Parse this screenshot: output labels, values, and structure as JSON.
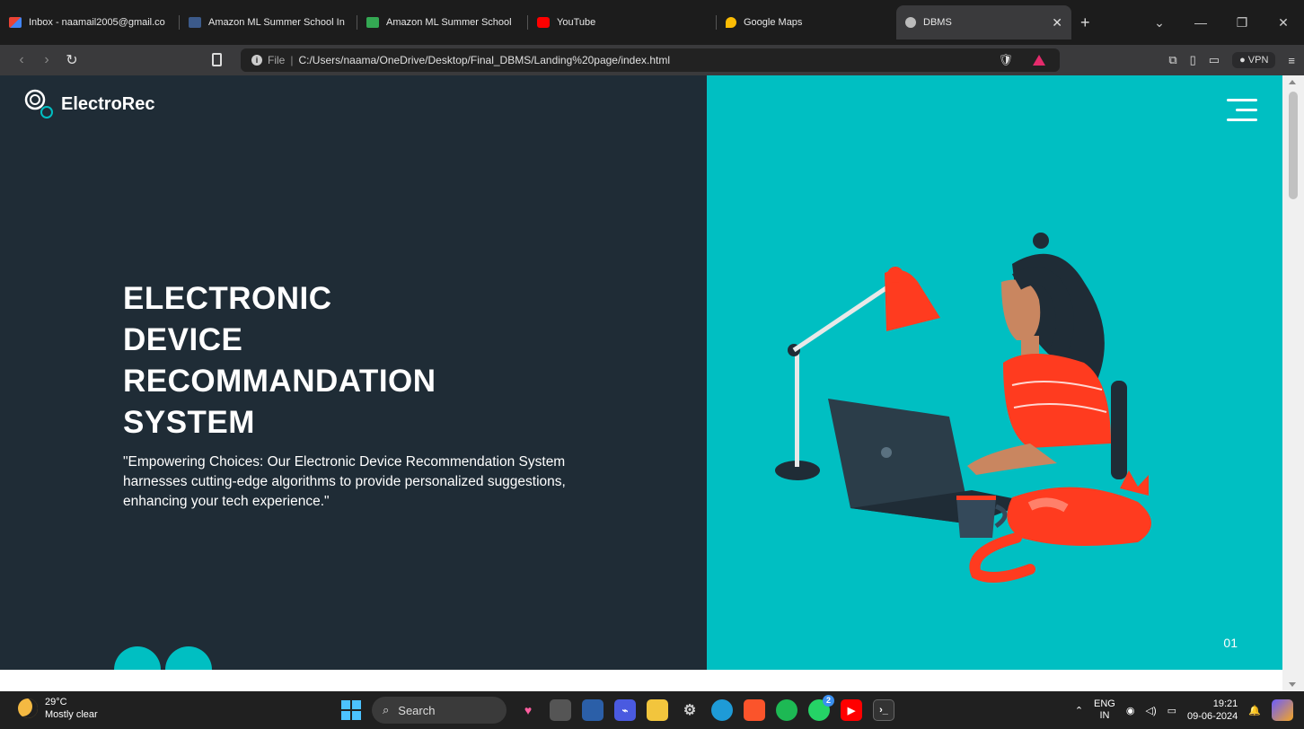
{
  "browser": {
    "tabs": [
      {
        "label": "Inbox - naamail2005@gmail.co",
        "icon": "gmail-icon",
        "color": "#ea4335"
      },
      {
        "label": "Amazon ML Summer School In",
        "icon": "amazon-icon",
        "color": "#8ab4f8"
      },
      {
        "label": "Amazon ML Summer School",
        "icon": "chart-icon",
        "color": "#34a853"
      },
      {
        "label": "YouTube",
        "icon": "youtube-icon",
        "color": "#ff0000"
      },
      {
        "label": "Google Maps",
        "icon": "maps-pin-icon",
        "color": "#fbbc04"
      },
      {
        "label": "DBMS",
        "icon": "globe-icon",
        "color": "#bbbbbb"
      }
    ],
    "url_prefix": "File",
    "url": "C:/Users/naama/OneDrive/Desktop/Final_DBMS/Landing%20page/index.html",
    "vpn_label": "VPN"
  },
  "page": {
    "brand": "ElectroRec",
    "hero_title_lines": [
      "ELECTRONIC",
      "DEVICE",
      "RECOMMANDATION",
      "SYSTEM"
    ],
    "hero_subtitle": "\"Empowering Choices: Our Electronic Device Recommendation System harnesses cutting-edge algorithms to provide personalized suggestions, enhancing your tech experience.\"",
    "prev_arrow": "←",
    "next_arrow": "→",
    "slide_number": "01",
    "colors": {
      "dark_panel": "#1f2c36",
      "accent": "#00bfc2"
    }
  },
  "taskbar": {
    "temperature": "29°C",
    "weather": "Mostly clear",
    "search_label": "Search",
    "lang_top": "ENG",
    "lang_bottom": "IN",
    "time": "19:21",
    "date": "09-06-2024",
    "whatsapp_badge": "2"
  }
}
